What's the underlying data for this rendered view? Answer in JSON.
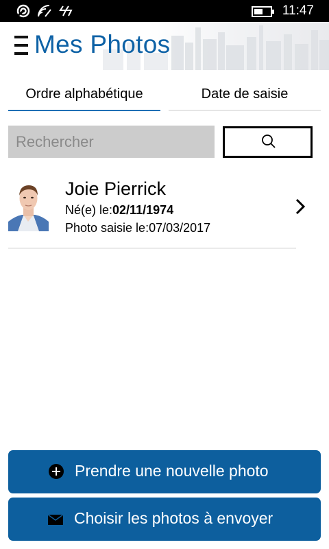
{
  "status_bar": {
    "time": "11:47"
  },
  "header": {
    "title": "Mes Photos"
  },
  "tabs": [
    {
      "label": "Ordre alphabétique",
      "selected": true
    },
    {
      "label": "Date de saisie",
      "selected": false
    }
  ],
  "search": {
    "placeholder": "Rechercher",
    "value": ""
  },
  "list": [
    {
      "name": "Joie Pierrick",
      "birth_label": "Né(e) le:",
      "birth_date": "02/11/1974",
      "saisie_label": "Photo saisie le:",
      "saisie_date": "07/03/2017"
    }
  ],
  "buttons": {
    "take_photo": "Prendre une nouvelle photo",
    "choose_photos": "Choisir les photos à envoyer"
  },
  "colors": {
    "accent": "#0e62a6",
    "button_bg": "#0d5f9e",
    "tab_underline": "#1f6fb5"
  }
}
